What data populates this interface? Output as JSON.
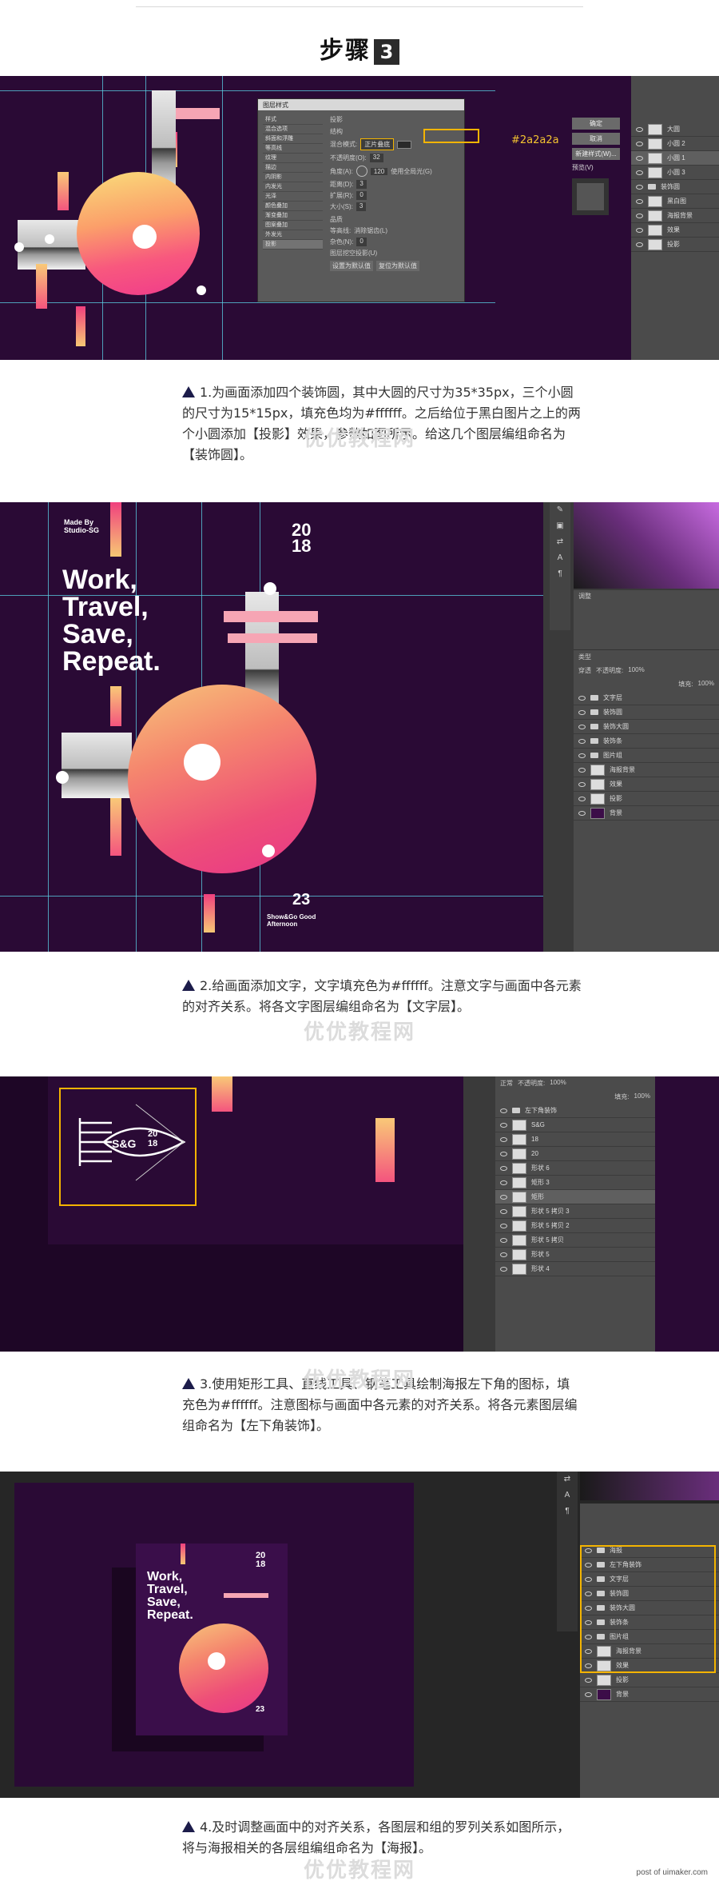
{
  "header": {
    "step_label": "步骤",
    "step_number": "3"
  },
  "colors": {
    "poster_bg": "#2a0a35",
    "accent_pink": "#f03b8b",
    "accent_yellow": "#f9dd7a",
    "highlight": "#f4b400",
    "ps_panel": "#4b4b4b"
  },
  "section1": {
    "dialog_title": "图层样式",
    "dialog_left_items": [
      "样式",
      "混合选项",
      "斜面和浮雕",
      "等高线",
      "纹理",
      "描边",
      "内阴影",
      "内发光",
      "光泽",
      "颜色叠加",
      "渐变叠加",
      "图案叠加",
      "外发光",
      "投影"
    ],
    "dialog_group": "投影",
    "dialog_group2": "结构",
    "blend_label": "混合模式:",
    "blend_value": "正片叠底",
    "opacity_label": "不透明度(O):",
    "opacity_value": "32",
    "angle_label": "角度(A):",
    "angle_value": "120",
    "global_light": "使用全局光(G)",
    "distance_label": "距离(D):",
    "distance_value": "3",
    "spread_label": "扩展(R):",
    "spread_value": "0",
    "size_label": "大小(S):",
    "size_value": "3",
    "quality_label": "品质",
    "contour_label": "等高线:",
    "antialias": "消除锯齿(L)",
    "noise_label": "杂色(N):",
    "noise_value": "0",
    "knockout": "图层挖空投影(U)",
    "btn_default": "设置为默认值",
    "btn_reset": "复位为默认值",
    "btn_ok": "确定",
    "btn_cancel": "取消",
    "btn_new": "新建样式(W)...",
    "preview": "预览(V)",
    "hex_note": "#2a2a2a",
    "layers": [
      "大圆",
      "小圆 2",
      "小圆 1",
      "小圆 3",
      "装饰圆",
      "黑白图",
      "海报背景",
      "效果",
      "投影"
    ],
    "caption": "1.为画面添加四个装饰圆，其中大圆的尺寸为35*35px，三个小圆的尺寸为15*15px，填充色均为#ffffff。之后给位于黑白图片之上的两个小圆添加【投影】效果，参数如图所示。给这几个图层编组命名为【装饰圆】。"
  },
  "section2": {
    "made_by": "Made By Studio-SG",
    "year": "20 18",
    "headline": [
      "Work,",
      "Travel,",
      "Save,",
      "Repeat."
    ],
    "number": "23",
    "sub": "Show&Go Good Afternoon",
    "panel_tab": "调整",
    "blend_mode": "穿透",
    "opacity_label": "不透明度:",
    "opacity_value": "100%",
    "fill_label": "填充:",
    "fill_value": "100%",
    "kind_label": "类型",
    "layers": [
      "文字层",
      "装饰圆",
      "装饰大圆",
      "装饰条",
      "图片组",
      "海报背景",
      "效果",
      "投影",
      "背景"
    ],
    "caption": "2.给画面添加文字，文字填充色为#ffffff。注意文字与画面中各元素的对齐关系。将各文字图层编组命名为【文字层】。"
  },
  "section3": {
    "icon_text": "S&G",
    "icon_year": "20 18",
    "blend_mode": "正常",
    "opacity_label": "不透明度:",
    "opacity_value": "100%",
    "fill_label": "填充:",
    "fill_value": "100%",
    "layers": [
      "左下角装饰",
      "S&G",
      "18",
      "20",
      "形状 6",
      "矩形 3",
      "矩形",
      "形状 5 拷贝 3",
      "形状 5 拷贝 2",
      "形状 5 拷贝",
      "形状 5",
      "形状 4"
    ],
    "caption": "3.使用矩形工具、直线工具、钢笔工具绘制海报左下角的图标，填充色为#ffffff。注意图标与画面中各元素的对齐关系。将各元素图层编组命名为【左下角装饰】。"
  },
  "section4": {
    "headline": [
      "Work,",
      "Travel,",
      "Save,",
      "Repeat."
    ],
    "year": "20 18",
    "number": "23",
    "layers": [
      "海报",
      "左下角装饰",
      "文字层",
      "装饰圆",
      "装饰大圆",
      "装饰条",
      "图片组",
      "海报背景",
      "效果",
      "投影",
      "背景"
    ],
    "caption": "4.及时调整画面中的对齐关系，各图层和组的罗列关系如图所示，将与海报相关的各层组编组命名为【海报】。"
  },
  "watermark": "优优教程网",
  "footer": "post of uimaker.com"
}
